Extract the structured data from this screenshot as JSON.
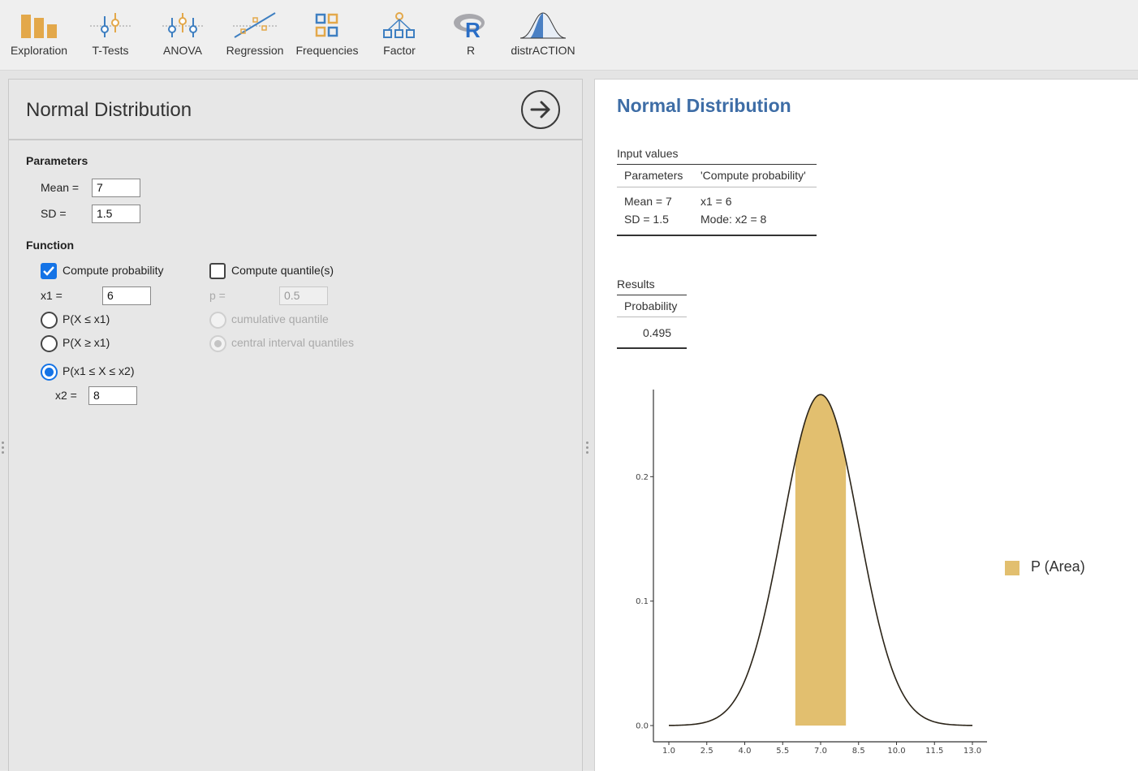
{
  "toolbar": {
    "items": [
      {
        "label": "Exploration",
        "icon": "exploration-icon"
      },
      {
        "label": "T-Tests",
        "icon": "t-tests-icon"
      },
      {
        "label": "ANOVA",
        "icon": "anova-icon"
      },
      {
        "label": "Regression",
        "icon": "regression-icon"
      },
      {
        "label": "Frequencies",
        "icon": "frequencies-icon"
      },
      {
        "label": "Factor",
        "icon": "factor-icon"
      },
      {
        "label": "R",
        "icon": "r-logo-icon"
      },
      {
        "label": "distrACTION",
        "icon": "distraction-icon"
      }
    ]
  },
  "options": {
    "title": "Normal Distribution",
    "parameters_heading": "Parameters",
    "mean_label": "Mean =",
    "mean_value": "7",
    "sd_label": "SD =",
    "sd_value": "1.5",
    "function_heading": "Function",
    "compute_probability_label": "Compute probability",
    "compute_probability_checked": true,
    "x1_label": "x1 =",
    "x1_value": "6",
    "radio_leq_label": "P(X ≤ x1)",
    "radio_geq_label": "P(X ≥ x1)",
    "radio_between_label": "P(x1 ≤ X ≤ x2)",
    "selected_mode": "between",
    "x2_label": "x2 =",
    "x2_value": "8",
    "compute_quantiles_label": "Compute quantile(s)",
    "compute_quantiles_checked": false,
    "p_label": "p =",
    "p_value": "0.5",
    "cumulative_quantile_label": "cumulative quantile",
    "central_interval_label": "central interval quantiles"
  },
  "results": {
    "title": "Normal Distribution",
    "input_table": {
      "caption": "Input values",
      "headers": [
        "Parameters",
        "'Compute probability'"
      ],
      "rows": [
        [
          "Mean = 7",
          "x1 = 6"
        ],
        [
          "SD = 1.5",
          "Mode: x2 = 8"
        ]
      ]
    },
    "results_table": {
      "caption": "Results",
      "header": "Probability",
      "value": "0.495"
    },
    "legend_label": "P (Area)"
  },
  "chart_data": {
    "type": "area",
    "title": "",
    "xlabel": "",
    "ylabel": "",
    "distribution": {
      "family": "normal",
      "mean": 7,
      "sd": 1.5
    },
    "curve_x_range": [
      1.0,
      13.0
    ],
    "shaded_interval": [
      6,
      8
    ],
    "x_ticks": [
      "1.0",
      "2.5",
      "4.0",
      "5.5",
      "7.0",
      "8.5",
      "10.0",
      "11.5",
      "13.0"
    ],
    "y_ticks": [
      "0.0",
      "0.1",
      "0.2"
    ],
    "ylim": [
      0,
      0.27
    ],
    "grid": false,
    "legend_position": "right",
    "series": [
      {
        "name": "P (Area)",
        "color": "#e2bf6f"
      }
    ],
    "curve_color": "#2b2418"
  }
}
